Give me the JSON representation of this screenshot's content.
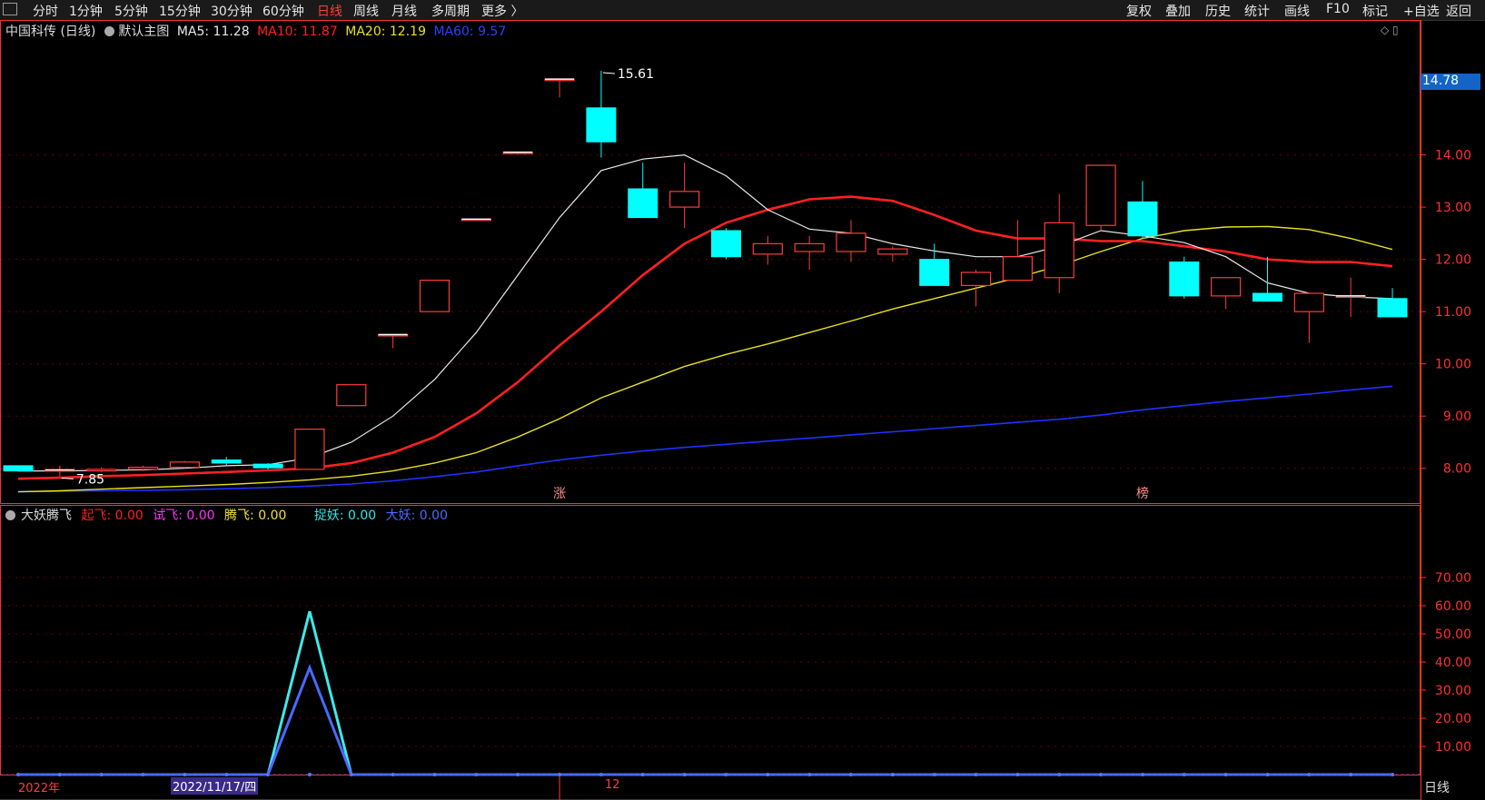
{
  "toolbar": {
    "left_items": [
      {
        "label": "分时",
        "x": 36
      },
      {
        "label": "1分钟",
        "x": 76
      },
      {
        "label": "5分钟",
        "x": 126
      },
      {
        "label": "15分钟",
        "x": 175
      },
      {
        "label": "30分钟",
        "x": 232
      },
      {
        "label": "60分钟",
        "x": 289
      },
      {
        "label": "日线",
        "x": 349,
        "active": true
      },
      {
        "label": "周线",
        "x": 389
      },
      {
        "label": "月线",
        "x": 431
      },
      {
        "label": "多周期",
        "x": 475
      },
      {
        "label": "更多 〉",
        "x": 530
      }
    ],
    "right_items": [
      {
        "label": "复权",
        "x": 1240
      },
      {
        "label": "叠加",
        "x": 1283
      },
      {
        "label": "历史",
        "x": 1327
      },
      {
        "label": "统计",
        "x": 1370
      },
      {
        "label": "画线",
        "x": 1414
      },
      {
        "label": "F10",
        "x": 1460
      },
      {
        "label": "标记",
        "x": 1500
      },
      {
        "label": "+自选",
        "x": 1545
      },
      {
        "label": "返回",
        "x": 1592
      }
    ]
  },
  "main_header": {
    "stock": "中国科传 (日线)",
    "template": "默认主图",
    "ma5": "MA5: 11.28",
    "ma10": "MA10: 11.87",
    "ma20": "MA20: 12.19",
    "ma60": "MA60: 9.57"
  },
  "indicator_header": {
    "name": "大妖腾飞",
    "qifei": "起飞: 0.00",
    "shifei": "试飞: 0.00",
    "tengfei": "腾飞: 0.00",
    "zhuoyao": "捉妖: 0.00",
    "dayao": "大妖: 0.00"
  },
  "price_label": "14.78",
  "period_label": "日线",
  "date_left": "2022年",
  "date_cursor": "2022/11/17/四",
  "date_mid": "12",
  "colors": {
    "up": "#ff3b3b",
    "down": "#00ffff",
    "ma5": "#e8e8e8",
    "ma10": "#ff2020",
    "ma20": "#e8e020",
    "ma60": "#1e32ff",
    "grid": "#6a0000",
    "axis": "#ff3030"
  },
  "chart_data": [
    {
      "type": "candlestick",
      "title": "中国科传 (日线)",
      "ylim": [
        7.3,
        16.2
      ],
      "yticks": [
        8.0,
        9.0,
        10.0,
        11.0,
        12.0,
        13.0,
        14.0
      ],
      "annotations": [
        {
          "text": "15.61",
          "index": 14,
          "kind": "high"
        },
        {
          "text": "7.85",
          "index": 1,
          "kind": "low"
        }
      ],
      "markers": [
        {
          "text": "涨",
          "index": 13
        },
        {
          "text": "榜",
          "index": 27
        }
      ],
      "candles": [
        {
          "o": 8.05,
          "c": 7.95,
          "h": 8.05,
          "l": 7.95
        },
        {
          "o": 7.95,
          "c": 7.97,
          "h": 8.05,
          "l": 7.85
        },
        {
          "o": 7.95,
          "c": 7.98,
          "h": 8.02,
          "l": 7.93
        },
        {
          "o": 7.98,
          "c": 8.02,
          "h": 8.05,
          "l": 7.95
        },
        {
          "o": 8.02,
          "c": 8.12,
          "h": 8.14,
          "l": 8.0
        },
        {
          "o": 8.16,
          "c": 8.1,
          "h": 8.22,
          "l": 8.05
        },
        {
          "o": 8.08,
          "c": 8.01,
          "h": 8.1,
          "l": 7.98
        },
        {
          "o": 7.98,
          "c": 8.75,
          "h": 8.75,
          "l": 7.98
        },
        {
          "o": 9.2,
          "c": 9.6,
          "h": 9.6,
          "l": 9.2
        },
        {
          "o": 10.56,
          "c": 10.56,
          "h": 10.56,
          "l": 10.3
        },
        {
          "o": 11.0,
          "c": 11.6,
          "h": 11.6,
          "l": 11.0
        },
        {
          "o": 12.77,
          "c": 12.77,
          "h": 12.77,
          "l": 12.77
        },
        {
          "o": 14.05,
          "c": 14.05,
          "h": 14.05,
          "l": 14.05
        },
        {
          "o": 15.45,
          "c": 15.45,
          "h": 15.45,
          "l": 15.1
        },
        {
          "o": 14.9,
          "c": 14.25,
          "h": 15.61,
          "l": 13.95
        },
        {
          "o": 13.35,
          "c": 12.8,
          "h": 13.85,
          "l": 12.8
        },
        {
          "o": 13.0,
          "c": 13.3,
          "h": 13.85,
          "l": 12.6
        },
        {
          "o": 12.55,
          "c": 12.05,
          "h": 12.6,
          "l": 12.0
        },
        {
          "o": 12.1,
          "c": 12.3,
          "h": 12.45,
          "l": 11.9
        },
        {
          "o": 12.15,
          "c": 12.3,
          "h": 12.45,
          "l": 11.8
        },
        {
          "o": 12.15,
          "c": 12.5,
          "h": 12.75,
          "l": 11.95
        },
        {
          "o": 12.1,
          "c": 12.2,
          "h": 12.25,
          "l": 11.95
        },
        {
          "o": 12.0,
          "c": 11.5,
          "h": 12.3,
          "l": 11.5
        },
        {
          "o": 11.5,
          "c": 11.75,
          "h": 11.8,
          "l": 11.1
        },
        {
          "o": 11.6,
          "c": 12.05,
          "h": 12.75,
          "l": 11.6
        },
        {
          "o": 11.65,
          "c": 12.7,
          "h": 13.25,
          "l": 11.35
        },
        {
          "o": 12.65,
          "c": 13.8,
          "h": 13.8,
          "l": 12.55
        },
        {
          "o": 13.1,
          "c": 12.45,
          "h": 13.5,
          "l": 12.4
        },
        {
          "o": 11.95,
          "c": 11.3,
          "h": 12.05,
          "l": 11.25
        },
        {
          "o": 11.3,
          "c": 11.65,
          "h": 11.65,
          "l": 11.05
        },
        {
          "o": 11.35,
          "c": 11.2,
          "h": 12.05,
          "l": 11.2
        },
        {
          "o": 11.0,
          "c": 11.35,
          "h": 11.35,
          "l": 10.4
        },
        {
          "o": 11.3,
          "c": 11.3,
          "h": 11.65,
          "l": 10.9
        },
        {
          "o": 11.25,
          "c": 10.9,
          "h": 11.45,
          "l": 10.9
        }
      ],
      "ma5": [
        7.95,
        7.95,
        7.96,
        7.97,
        8.0,
        8.05,
        8.07,
        8.2,
        8.5,
        9.0,
        9.7,
        10.6,
        11.7,
        12.8,
        13.7,
        13.92,
        14.0,
        13.6,
        12.95,
        12.58,
        12.5,
        12.3,
        12.16,
        12.05,
        12.05,
        12.25,
        12.55,
        12.45,
        12.32,
        12.05,
        11.55,
        11.35,
        11.28,
        11.25
      ],
      "ma10": [
        7.8,
        7.82,
        7.85,
        7.87,
        7.9,
        7.93,
        7.96,
        8.0,
        8.1,
        8.3,
        8.6,
        9.05,
        9.65,
        10.35,
        11.0,
        11.7,
        12.3,
        12.7,
        12.95,
        13.15,
        13.2,
        13.12,
        12.85,
        12.55,
        12.4,
        12.4,
        12.35,
        12.35,
        12.25,
        12.15,
        12.0,
        11.95,
        11.95,
        11.87
      ],
      "ma20": [
        7.55,
        7.57,
        7.6,
        7.63,
        7.66,
        7.69,
        7.73,
        7.78,
        7.85,
        7.95,
        8.1,
        8.3,
        8.6,
        8.95,
        9.35,
        9.65,
        9.95,
        10.18,
        10.38,
        10.6,
        10.82,
        11.05,
        11.25,
        11.45,
        11.65,
        11.88,
        12.15,
        12.4,
        12.55,
        12.62,
        12.63,
        12.57,
        12.4,
        12.19
      ],
      "ma60": [
        7.55,
        7.56,
        7.57,
        7.58,
        7.59,
        7.61,
        7.63,
        7.66,
        7.7,
        7.76,
        7.84,
        7.93,
        8.05,
        8.16,
        8.25,
        8.33,
        8.4,
        8.46,
        8.52,
        8.58,
        8.64,
        8.7,
        8.76,
        8.82,
        8.88,
        8.94,
        9.02,
        9.12,
        9.2,
        9.28,
        9.35,
        9.42,
        9.5,
        9.57
      ]
    },
    {
      "type": "line",
      "title": "大妖腾飞",
      "ylim": [
        0,
        80
      ],
      "yticks": [
        10.0,
        20.0,
        30.0,
        40.0,
        50.0,
        60.0,
        70.0
      ],
      "series": [
        {
          "name": "捉妖",
          "values": [
            0,
            0,
            0,
            0,
            0,
            0,
            0,
            58,
            0,
            0,
            0,
            0,
            0,
            0,
            0,
            0,
            0,
            0,
            0,
            0,
            0,
            0,
            0,
            0,
            0,
            0,
            0,
            0,
            0,
            0,
            0,
            0,
            0,
            0
          ]
        },
        {
          "name": "大妖",
          "values": [
            0,
            0,
            0,
            0,
            0,
            0,
            0,
            38,
            0,
            0,
            0,
            0,
            0,
            0,
            0,
            0,
            0,
            0,
            0,
            0,
            0,
            0,
            0,
            0,
            0,
            0,
            0,
            0,
            0,
            0,
            0,
            0,
            0,
            0
          ]
        }
      ]
    }
  ]
}
